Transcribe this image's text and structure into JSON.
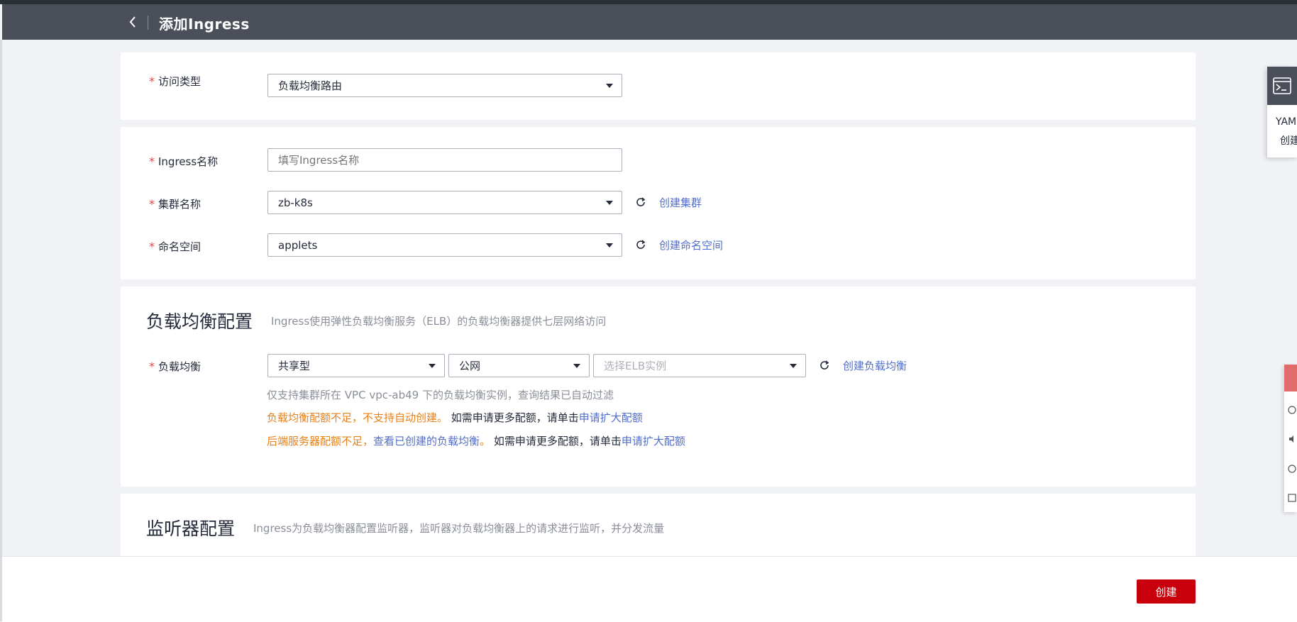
{
  "header": {
    "back_icon": "chevron-left-icon",
    "title": "添加Ingress"
  },
  "access_type": {
    "label": "访问类型",
    "value": "负载均衡路由"
  },
  "basic": {
    "ingress_name": {
      "label": "Ingress名称",
      "placeholder": "填写Ingress名称",
      "value": ""
    },
    "cluster": {
      "label": "集群名称",
      "value": "zb-k8s",
      "create_link": "创建集群"
    },
    "namespace": {
      "label": "命名空间",
      "value": "applets",
      "create_link": "创建命名空间"
    }
  },
  "lb_config": {
    "title": "负载均衡配置",
    "description": "Ingress使用弹性负载均衡服务（ELB）的负载均衡器提供七层网络访问",
    "label": "负载均衡",
    "type_value": "共享型",
    "network_value": "公网",
    "elb_placeholder": "选择ELB实例",
    "create_link": "创建负载均衡",
    "hint_vpc": "仅支持集群所在 VPC vpc-ab49 下的负载均衡实例，查询结果已自动过滤",
    "warn1_orange": "负载均衡配额不足，不支持自动创建。",
    "warn1_text": " 如需申请更多配额，请单击",
    "warn1_link": "申请扩大配额",
    "warn2_orange": "后端服务器配额不足，",
    "warn2_view_link": "查看已创建的负载均衡",
    "warn2_orange_end": "。",
    "warn2_text": " 如需申请更多配额，请单击",
    "warn2_link": "申请扩大配额"
  },
  "listener_config": {
    "title": "监听器配置",
    "description": "Ingress为负载均衡器配置监听器，监听器对负载均衡器上的请求进行监听，并分发流量"
  },
  "footer": {
    "create_button": "创建"
  },
  "yaml_widget": {
    "icon": "terminal-icon",
    "line1": "YAM",
    "line2": "创建"
  },
  "colors": {
    "header_bg": "#4b4f5a",
    "primary_red": "#c7000b",
    "link_blue": "#526ecc",
    "warning_orange": "#e8801a",
    "required_star": "#e54545"
  }
}
